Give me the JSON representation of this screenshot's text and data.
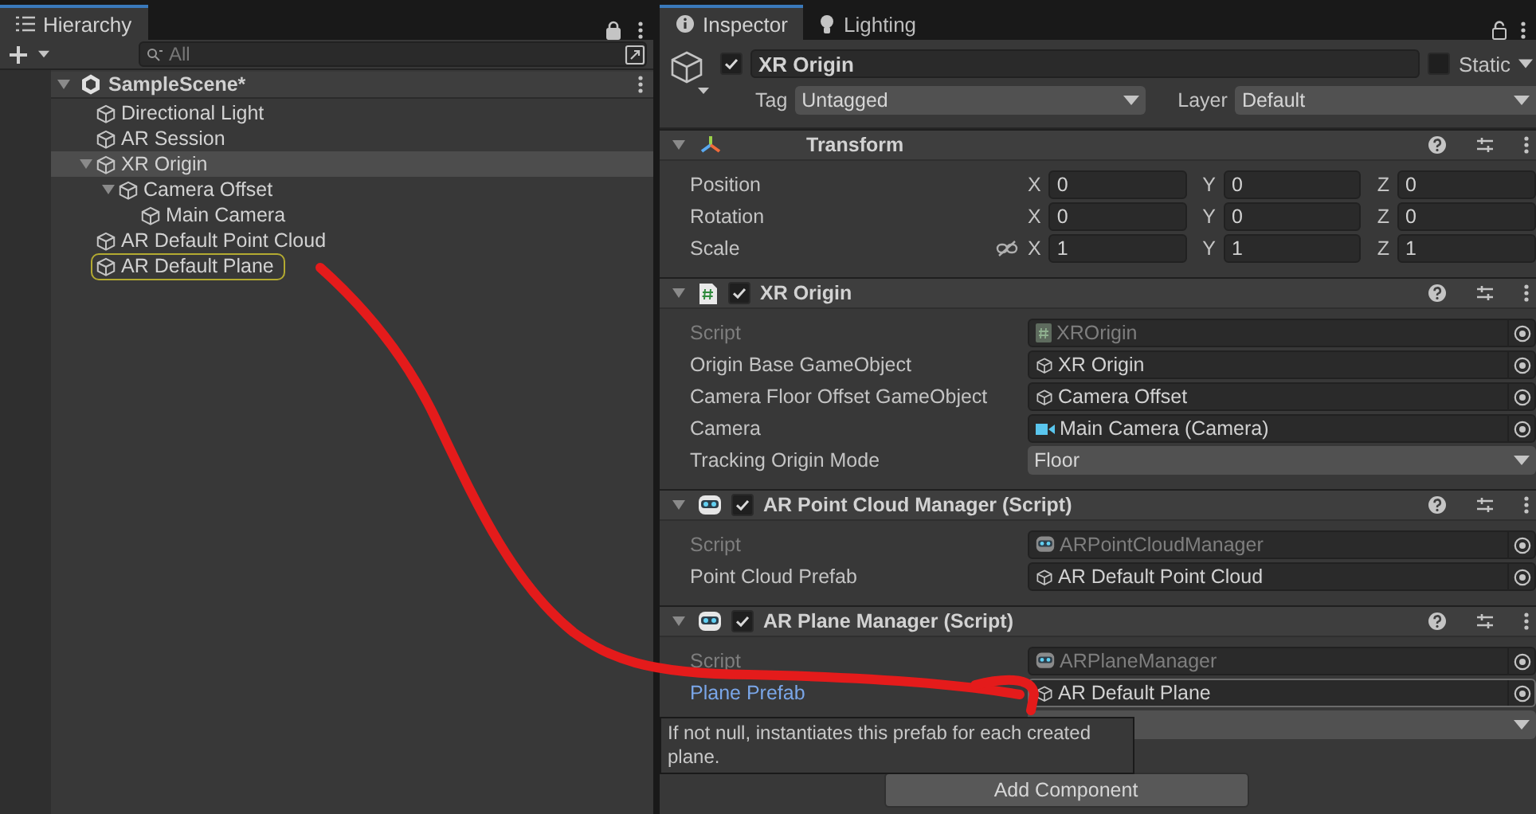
{
  "hierarchy": {
    "tab": "Hierarchy",
    "search": {
      "placeholder": "All"
    },
    "scene": {
      "name": "SampleScene*",
      "expanded": true
    },
    "items": [
      {
        "name": "Directional Light",
        "selected": false,
        "highlighted": false
      },
      {
        "name": "AR Session",
        "selected": false,
        "highlighted": false
      },
      {
        "name": "XR Origin",
        "selected": true,
        "highlighted": false,
        "expanded": true,
        "children": [
          {
            "name": "Camera Offset",
            "selected": false,
            "highlighted": false,
            "expanded": true,
            "children": [
              {
                "name": "Main Camera",
                "selected": false,
                "highlighted": false
              }
            ]
          }
        ]
      },
      {
        "name": "AR Default Point Cloud",
        "selected": false,
        "highlighted": false
      },
      {
        "name": "AR Default Plane",
        "selected": false,
        "highlighted": true
      }
    ]
  },
  "inspector": {
    "tabs": [
      {
        "label": "Inspector",
        "selected": true
      },
      {
        "label": "Lighting",
        "selected": false
      }
    ],
    "object": {
      "active": true,
      "name": "XR Origin",
      "static": false,
      "static_label": "Static",
      "tag_label": "Tag",
      "tag": "Untagged",
      "layer_label": "Layer",
      "layer": "Default"
    },
    "components": [
      {
        "kind": "transform",
        "title": "Transform",
        "expanded": true,
        "rows": [
          {
            "label": "Position",
            "axes": [
              {
                "axis": "X",
                "value": "0"
              },
              {
                "axis": "Y",
                "value": "0"
              },
              {
                "axis": "Z",
                "value": "0"
              }
            ]
          },
          {
            "label": "Rotation",
            "axes": [
              {
                "axis": "X",
                "value": "0"
              },
              {
                "axis": "Y",
                "value": "0"
              },
              {
                "axis": "Z",
                "value": "0"
              }
            ]
          },
          {
            "label": "Scale",
            "proportional": false,
            "axes": [
              {
                "axis": "X",
                "value": "1"
              },
              {
                "axis": "Y",
                "value": "1"
              },
              {
                "axis": "Z",
                "value": "1"
              }
            ]
          }
        ]
      },
      {
        "kind": "script",
        "title": "XR Origin",
        "enabled": true,
        "expanded": true,
        "rows": [
          {
            "kind": "script",
            "label": "Script",
            "value": "XROrigin",
            "disabled": true,
            "hovered": false
          },
          {
            "kind": "gameobject",
            "label": "Origin Base GameObject",
            "value": "XR Origin",
            "disabled": false,
            "hovered": false
          },
          {
            "kind": "gameobject",
            "label": "Camera Floor Offset GameObject",
            "value": "Camera Offset",
            "disabled": false,
            "hovered": false
          },
          {
            "kind": "camera",
            "label": "Camera",
            "value": "Main Camera (Camera)",
            "disabled": false,
            "hovered": false
          },
          {
            "kind": "dropdown",
            "label": "Tracking Origin Mode",
            "value": "Floor"
          }
        ]
      },
      {
        "kind": "ar-script",
        "title": "AR Point Cloud Manager (Script)",
        "enabled": true,
        "expanded": true,
        "rows": [
          {
            "kind": "script",
            "label": "Script",
            "value": "ARPointCloudManager",
            "disabled": true,
            "hovered": false
          },
          {
            "kind": "gameobject",
            "label": "Point Cloud Prefab",
            "value": "AR Default Point Cloud",
            "disabled": false,
            "hovered": false
          }
        ]
      },
      {
        "kind": "ar-script",
        "title": "AR Plane Manager (Script)",
        "enabled": true,
        "expanded": true,
        "rows": [
          {
            "kind": "script",
            "label": "Script",
            "value": "ARPlaneManager",
            "disabled": true,
            "hovered": false
          },
          {
            "kind": "gameobject",
            "label": "Plane Prefab",
            "value": "AR Default Plane",
            "disabled": false,
            "hovered": true
          },
          {
            "kind": "dropdown"
          }
        ]
      }
    ],
    "add_button": "Add Component",
    "tooltip": {
      "text": "If not null, instantiates this prefab for each created plane."
    }
  },
  "annotation": {
    "kind": "freehand-arrow"
  }
}
